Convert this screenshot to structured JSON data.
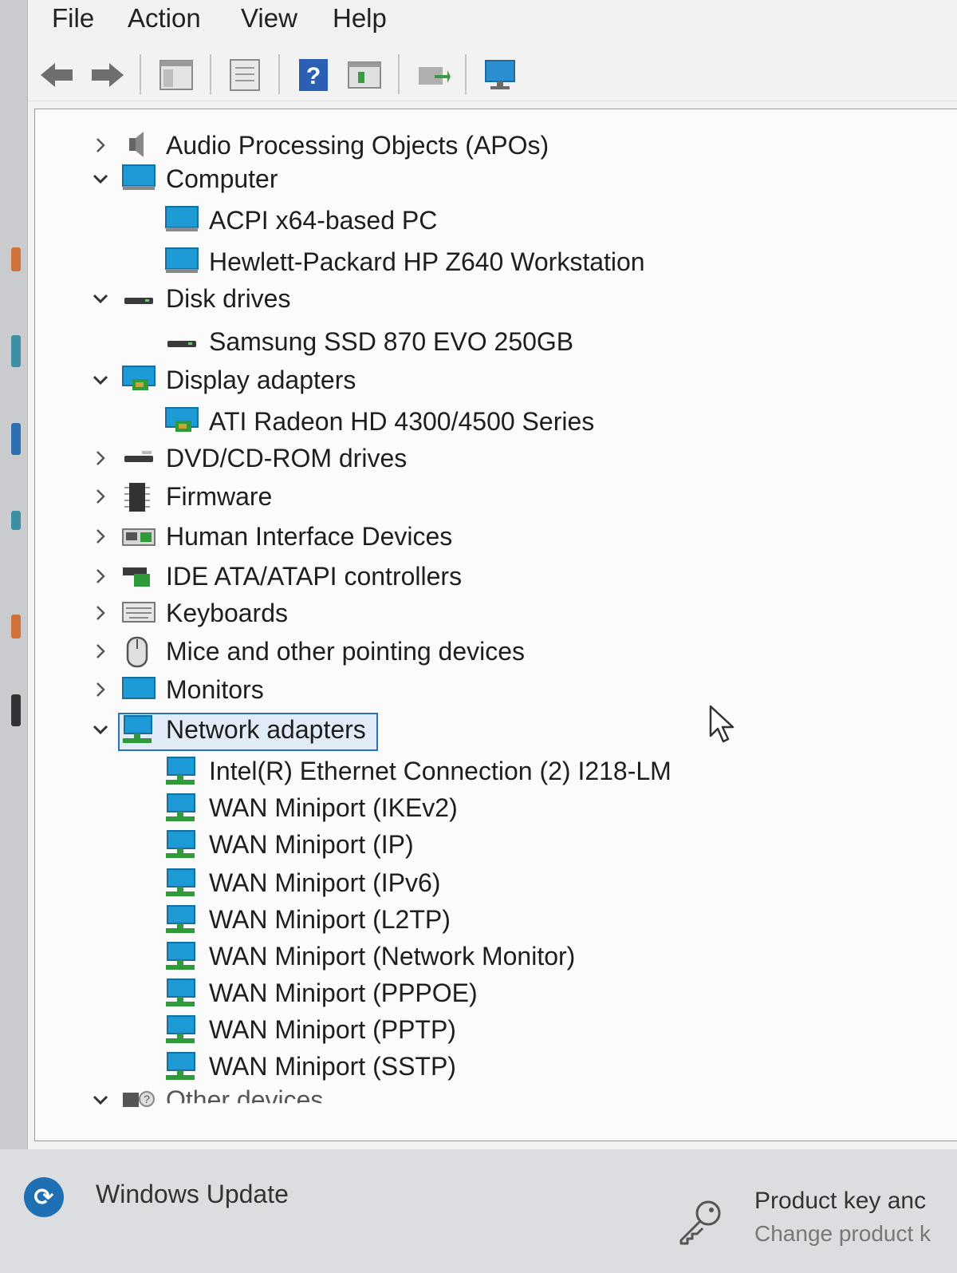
{
  "menu": [
    "File",
    "Action",
    "View",
    "Help"
  ],
  "toolbar": {
    "buttons": [
      "back-icon",
      "forward-icon",
      "show-hide-console-tree-icon",
      "properties-icon",
      "help-icon",
      "view-icon",
      "update-driver-icon",
      "scan-hardware-icon"
    ]
  },
  "tree": [
    {
      "label": "Audio Processing Objects (APOs)",
      "expander": ">",
      "icon": "audio-icon"
    },
    {
      "label": "Computer",
      "expander": "v",
      "icon": "computer-icon"
    },
    {
      "label": "ACPI x64-based PC",
      "icon": "computer-icon"
    },
    {
      "label": "Hewlett-Packard HP Z640 Workstation",
      "icon": "computer-icon"
    },
    {
      "label": "Disk drives",
      "expander": "v",
      "icon": "disk-icon"
    },
    {
      "label": "Samsung SSD 870 EVO 250GB",
      "icon": "disk-icon"
    },
    {
      "label": "Display adapters",
      "expander": "v",
      "icon": "display-adapter-icon"
    },
    {
      "label": "ATI Radeon HD 4300/4500 Series",
      "icon": "display-adapter-icon"
    },
    {
      "label": "DVD/CD-ROM drives",
      "expander": ">",
      "icon": "dvd-drive-icon"
    },
    {
      "label": "Firmware",
      "expander": ">",
      "icon": "firmware-icon"
    },
    {
      "label": "Human Interface Devices",
      "expander": ">",
      "icon": "hid-icon"
    },
    {
      "label": "IDE ATA/ATAPI controllers",
      "expander": ">",
      "icon": "ide-controller-icon"
    },
    {
      "label": "Keyboards",
      "expander": ">",
      "icon": "keyboard-icon"
    },
    {
      "label": "Mice and other pointing devices",
      "expander": ">",
      "icon": "mouse-icon"
    },
    {
      "label": "Monitors",
      "expander": ">",
      "icon": "monitor-icon"
    },
    {
      "label": "Network adapters",
      "expander": "v",
      "icon": "network-icon"
    },
    {
      "label": "Intel(R) Ethernet Connection (2) I218-LM",
      "icon": "network-icon"
    },
    {
      "label": "WAN Miniport (IKEv2)",
      "icon": "network-icon"
    },
    {
      "label": "WAN Miniport (IP)",
      "icon": "network-icon"
    },
    {
      "label": "WAN Miniport (IPv6)",
      "icon": "network-icon"
    },
    {
      "label": "WAN Miniport (L2TP)",
      "icon": "network-icon"
    },
    {
      "label": "WAN Miniport (Network Monitor)",
      "icon": "network-icon"
    },
    {
      "label": "WAN Miniport (PPPOE)",
      "icon": "network-icon"
    },
    {
      "label": "WAN Miniport (PPTP)",
      "icon": "network-icon"
    },
    {
      "label": "WAN Miniport (SSTP)",
      "icon": "network-icon"
    },
    {
      "label": "Other devices",
      "expander": "v",
      "icon": "unknown-device-icon"
    }
  ],
  "selected": "Network adapters",
  "bottom": {
    "windows_update": "Windows Update",
    "product_key_title": "Product key anc",
    "product_key_sub": "Change product k"
  },
  "colors": {
    "selection_border": "#2b6fc2",
    "selection_fill": "#e1ecf8",
    "device_blue": "#1e9bd7",
    "device_green": "#2e9a3a"
  }
}
